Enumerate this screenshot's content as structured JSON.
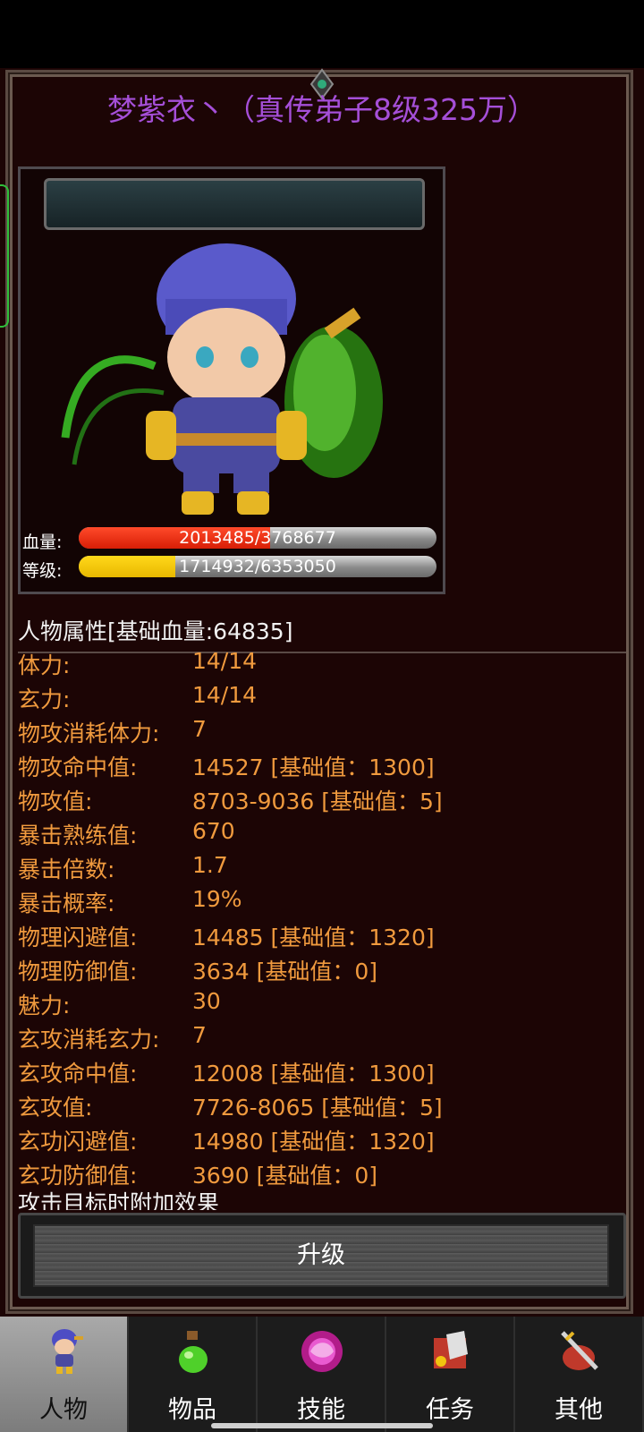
{
  "title": "梦紫衣丶（真传弟子8级325万）",
  "stats": {
    "hp_label": "血量:",
    "hp_text": "2013485/3768677",
    "hp_fraction": 0.534,
    "level_label": "等级:",
    "level_text": "1714932/6353050",
    "level_fraction": 0.27
  },
  "attributes": {
    "header": "人物属性[基础血量:64835]",
    "rows": [
      {
        "key": "体力:",
        "value": "14/14"
      },
      {
        "key": "玄力:",
        "value": "14/14"
      },
      {
        "key": "物攻消耗体力:",
        "value": "7"
      },
      {
        "key": "物攻命中值:",
        "value": "14527 [基础值：1300]"
      },
      {
        "key": "物攻值:",
        "value": "8703-9036 [基础值：5]"
      },
      {
        "key": "暴击熟练值:",
        "value": "670"
      },
      {
        "key": "暴击倍数:",
        "value": "1.7"
      },
      {
        "key": "暴击概率:",
        "value": "19%"
      },
      {
        "key": "物理闪避值:",
        "value": "14485 [基础值：1320]"
      },
      {
        "key": "物理防御值:",
        "value": "3634 [基础值：0]"
      },
      {
        "key": "魅力:",
        "value": "30"
      },
      {
        "key": "玄攻消耗玄力:",
        "value": "7"
      },
      {
        "key": "玄攻命中值:",
        "value": "12008 [基础值：1300]"
      },
      {
        "key": "玄攻值:",
        "value": "7726-8065 [基础值：5]"
      },
      {
        "key": "玄功闪避值:",
        "value": "14980 [基础值：1320]"
      },
      {
        "key": "玄功防御值:",
        "value": "3690 [基础值：0]"
      }
    ],
    "cut_text": "攻击目标时附加效果"
  },
  "upgrade_label": "升级",
  "tabs": [
    {
      "label": "人物",
      "icon": "character-icon"
    },
    {
      "label": "物品",
      "icon": "potion-icon"
    },
    {
      "label": "技能",
      "icon": "skill-orb-icon"
    },
    {
      "label": "任务",
      "icon": "quest-icon"
    },
    {
      "label": "其他",
      "icon": "sword-shield-icon"
    }
  ],
  "colors": {
    "title": "#a54fd8",
    "attribute_text": "#f09a3e",
    "hp_fill": "#e82a0e",
    "level_fill": "#f0c400",
    "background": "#1c0505"
  }
}
